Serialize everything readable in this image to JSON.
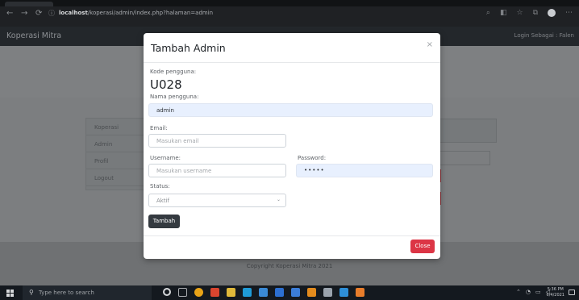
{
  "browser": {
    "url_host": "localhost",
    "url_path": "/koperasi/admin/index.php?halaman=admin",
    "nav_back": "←",
    "nav_forward": "→",
    "nav_reload": "⟳",
    "info": "ⓘ"
  },
  "app": {
    "brand": "Koperasi Mitra",
    "login_as": "Login Sebagai : Falen"
  },
  "sidebar": {
    "items": [
      "Koperasi",
      "Admin",
      "Profil",
      "Logout"
    ]
  },
  "modal": {
    "title": "Tambah Admin",
    "close_symbol": "×",
    "code_label": "Kode pengguna:",
    "code_value": "U028",
    "name_label": "Nama pengguna:",
    "name_value": "admin",
    "email_label": "Email:",
    "email_placeholder": "Masukan email",
    "username_label": "Username:",
    "username_placeholder": "Masukan username",
    "password_label": "Password:",
    "password_value": "•••••",
    "status_label": "Status:",
    "status_value": "Aktif",
    "submit_label": "Tambah",
    "close_label": "Close"
  },
  "footer": {
    "copyright": "Copyright Koperasi Mitra 2021"
  },
  "taskbar": {
    "search_placeholder": "Type here to search",
    "time": "5:36 PM",
    "date": "6/4/2021"
  },
  "colors": {
    "danger": "#dc3545",
    "dark_button": "#343a40",
    "autofill_bg": "#e8f0fe"
  }
}
